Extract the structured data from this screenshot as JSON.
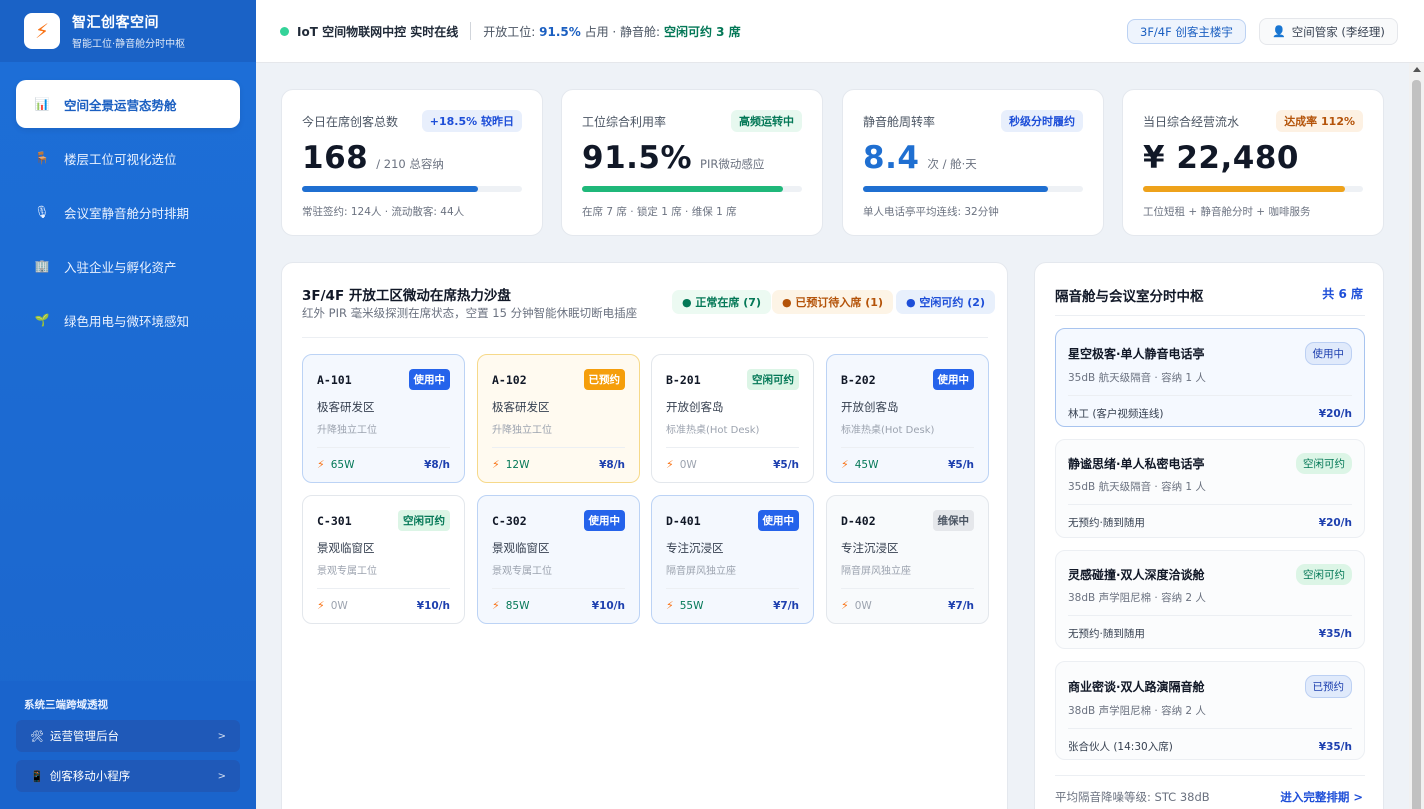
{
  "brand": {
    "logo": "⚡",
    "title": "智汇创客空间",
    "subtitle": "智能工位·静音舱分时中枢"
  },
  "nav": [
    {
      "icon": "📊",
      "label": "空间全景运营态势舱",
      "active": true
    },
    {
      "icon": "🪑",
      "label": "楼层工位可视化选位",
      "active": false
    },
    {
      "icon": "🎙",
      "label": "会议室静音舱分时排期",
      "active": false
    },
    {
      "icon": "🏢",
      "label": "入驻企业与孵化资产",
      "active": false
    },
    {
      "icon": "🌱",
      "label": "绿色用电与微环境感知",
      "active": false
    }
  ],
  "sidebar_footer": {
    "title": "系统三端跨域透视",
    "links": [
      {
        "icon": "🛠",
        "label": "运营管理后台",
        "chevron": ">"
      },
      {
        "icon": "📱",
        "label": "创客移动小程序",
        "chevron": ">"
      }
    ]
  },
  "topbar": {
    "status": "IoT 空间物联网中控 实时在线",
    "open_label": "开放工位:",
    "open_value": "91.5%",
    "open_suffix": "占用 · 静音舱:",
    "pods_value": "空闲可约 3 席",
    "floor_chip": "3F/4F 创客主楼宇",
    "user_icon": "👤",
    "user_chip": "空间管家 (李经理)"
  },
  "kpis": [
    {
      "label": "今日在席创客总数",
      "badge": "+18.5% 较昨日",
      "value": "168",
      "unit": "/ 210 总容纳",
      "progress": 0.8,
      "footer": "常驻签约: 124人 · 流动散客: 44人"
    },
    {
      "label": "工位综合利用率",
      "badge": "高频运转中",
      "value": "91.5%",
      "unit": "PIR微动感应",
      "progress": 0.915,
      "footer": "在席 7 席 · 锁定 1 席 · 维保 1 席"
    },
    {
      "label": "静音舱周转率",
      "badge": "秒级分时履约",
      "value": "8.4",
      "unit": "次 / 舱·天",
      "progress": 0.84,
      "footer": "单人电话亭平均连线: 32分钟"
    },
    {
      "label": "当日综合经营流水",
      "badge": "达成率 112%",
      "value": "¥ 22,480",
      "unit": "",
      "progress": 0.92,
      "footer": "工位短租 + 静音舱分时 + 咖啡服务"
    }
  ],
  "colors": {
    "kpi_bars": [
      "#1f6fd1",
      "#1fb87a",
      "#1f6fd1",
      "#eea21b"
    ]
  },
  "heatmap": {
    "title": "3F/4F 开放工区微动在席热力沙盘",
    "subtitle": "红外 PIR 毫米级探测在席状态，空置 15 分钟智能休眠切断电插座",
    "legend": [
      "● 正常在席 (7)",
      "● 已预订待入席 (1)",
      "● 空闲可约 (2)"
    ],
    "seats": [
      {
        "id": "A-101",
        "status": "使用中",
        "kind": "busy",
        "zone": "极客研发区",
        "type": "升降独立工位",
        "power": "65W",
        "price": "¥8/h"
      },
      {
        "id": "A-102",
        "status": "已预约",
        "kind": "res",
        "zone": "极客研发区",
        "type": "升降独立工位",
        "power": "12W",
        "price": "¥8/h"
      },
      {
        "id": "B-201",
        "status": "空闲可约",
        "kind": "free",
        "zone": "开放创客岛",
        "type": "标准热桌(Hot Desk)",
        "power": "0W",
        "price": "¥5/h"
      },
      {
        "id": "B-202",
        "status": "使用中",
        "kind": "busy",
        "zone": "开放创客岛",
        "type": "标准热桌(Hot Desk)",
        "power": "45W",
        "price": "¥5/h"
      },
      {
        "id": "C-301",
        "status": "空闲可约",
        "kind": "free",
        "zone": "景观临窗区",
        "type": "景观专属工位",
        "power": "0W",
        "price": "¥10/h"
      },
      {
        "id": "C-302",
        "status": "使用中",
        "kind": "busy",
        "zone": "景观临窗区",
        "type": "景观专属工位",
        "power": "85W",
        "price": "¥10/h"
      },
      {
        "id": "D-401",
        "status": "使用中",
        "kind": "busy",
        "zone": "专注沉浸区",
        "type": "隔音屏风独立座",
        "power": "55W",
        "price": "¥7/h"
      },
      {
        "id": "D-402",
        "status": "维保中",
        "kind": "maint",
        "zone": "专注沉浸区",
        "type": "隔音屏风独立座",
        "power": "0W",
        "price": "¥7/h"
      }
    ]
  },
  "pods": {
    "title": "隔音舱与会议室分时中枢",
    "count": "共 6 席",
    "items": [
      {
        "name": "星空极客·单人静音电话亭",
        "status": "使用中",
        "kind": "busy",
        "spec": "35dB 航天级隔音 · 容纳 1 人",
        "user": "林工 (客户视频连线)",
        "price": "¥20/h"
      },
      {
        "name": "静谧思绪·单人私密电话亭",
        "status": "空闲可约",
        "kind": "free",
        "spec": "35dB 航天级隔音 · 容纳 1 人",
        "user": "无预约·随到随用",
        "price": "¥20/h"
      },
      {
        "name": "灵感碰撞·双人深度洽谈舱",
        "status": "空闲可约",
        "kind": "free",
        "spec": "38dB 声学阻尼棉 · 容纳 2 人",
        "user": "无预约·随到随用",
        "price": "¥35/h"
      },
      {
        "name": "商业密谈·双人路演隔音舱",
        "status": "已预约",
        "kind": "res",
        "spec": "38dB 声学阻尼棉 · 容纳 2 人",
        "user": "张合伙人 (14:30入席)",
        "price": "¥35/h"
      }
    ],
    "footer": "平均隔音降噪等级: STC 38dB",
    "link": "进入完整排期 >"
  }
}
